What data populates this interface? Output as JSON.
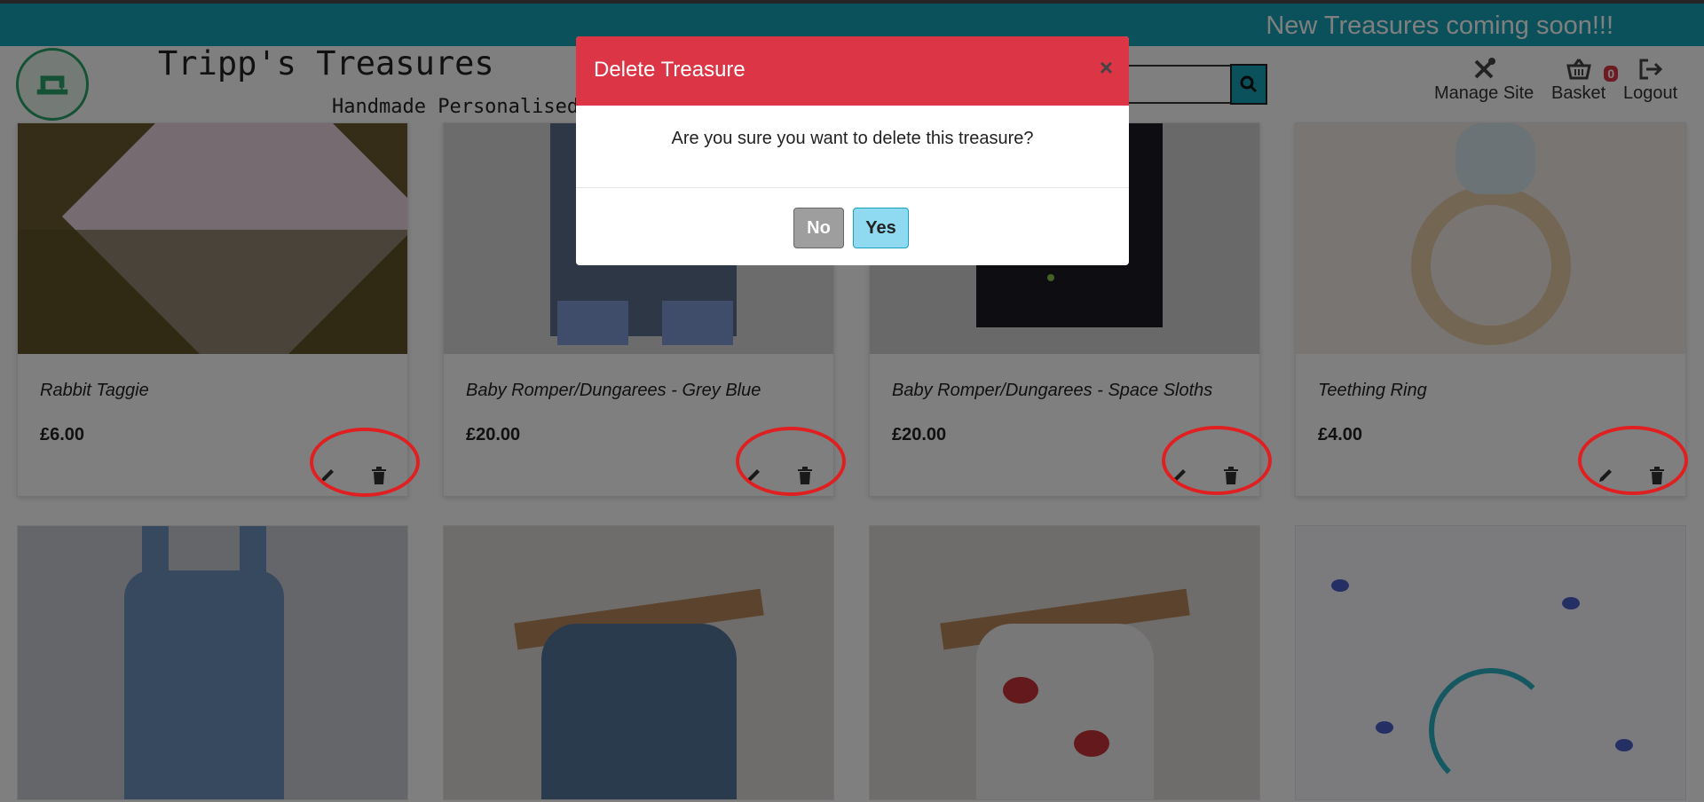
{
  "banner": {
    "text": "New Treasures coming soon!!!"
  },
  "brand": {
    "title": "Tripp's Treasures",
    "tagline": "Handmade Personalised"
  },
  "nav": {
    "manage": "Manage Site",
    "basket": "Basket",
    "basket_count": "0",
    "logout": "Logout"
  },
  "products": [
    {
      "name": "Rabbit Taggie",
      "price": "£6.00"
    },
    {
      "name": "Baby Romper/Dungarees - Grey Blue",
      "price": "£20.00"
    },
    {
      "name": "Baby Romper/Dungarees - Space Sloths",
      "price": "£20.00"
    },
    {
      "name": "Teething Ring",
      "price": "£4.00"
    }
  ],
  "modal": {
    "title": "Delete Treasure",
    "close": "×",
    "body": "Are you sure you want to delete this treasure?",
    "no": "No",
    "yes": "Yes"
  },
  "colors": {
    "banner": "#17a2b8",
    "modal_header": "#dc3545",
    "highlight_ring": "#e02020"
  }
}
